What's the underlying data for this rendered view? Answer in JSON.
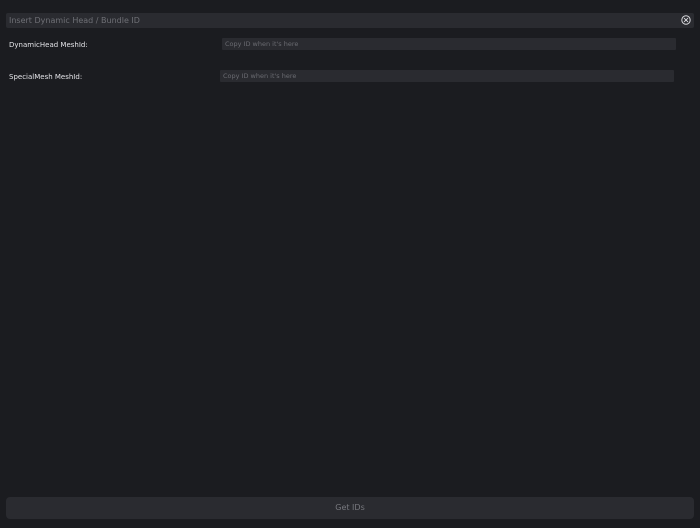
{
  "search": {
    "placeholder": "Insert Dynamic Head / Bundle ID",
    "value": "",
    "clear_icon": "close-circle-icon"
  },
  "fields": {
    "dynamic_head": {
      "label": "DynamicHead MeshId:",
      "placeholder": "Copy ID when it's here",
      "value": ""
    },
    "special_mesh": {
      "label": "SpecialMesh MeshId:",
      "placeholder": "Copy ID when it's here",
      "value": ""
    }
  },
  "action": {
    "label": "Get IDs"
  },
  "colors": {
    "background": "#1b1c20",
    "input_background": "#2a2b30",
    "label_text": "#e4e4e8",
    "placeholder_text": "#6f7076",
    "button_text": "#77787e"
  }
}
